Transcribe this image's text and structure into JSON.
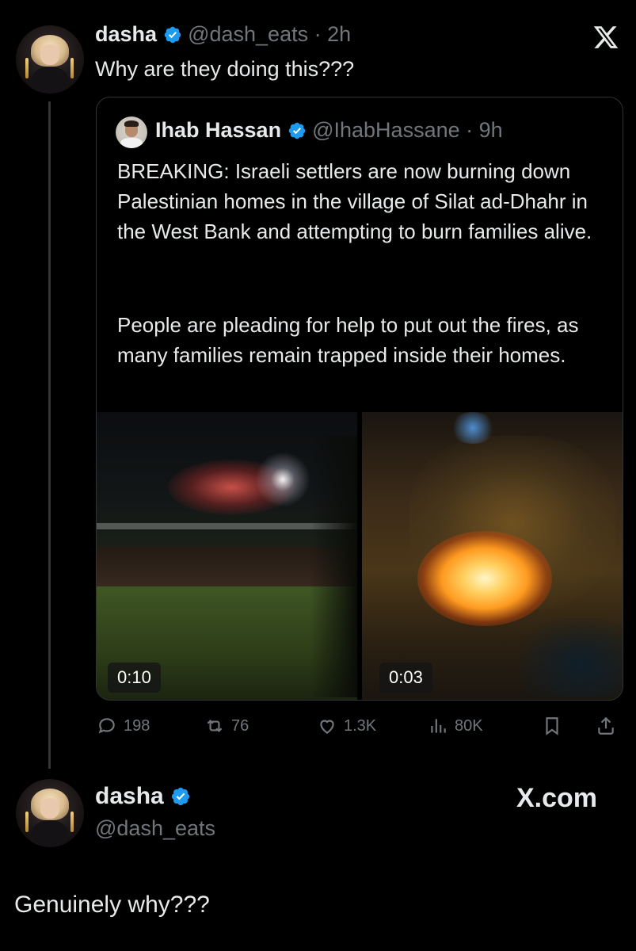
{
  "main_post": {
    "display_name": "dasha",
    "handle": "@dash_eats",
    "time": "· 2h",
    "text": "Why are they doing this???"
  },
  "quoted_post": {
    "display_name": "Ihab Hassan",
    "handle": "@IhabHassane",
    "time": "· 9h",
    "text_p1": "BREAKING: Israeli settlers are now burning down Palestinian homes in the village of Silat ad-Dhahr in the West Bank and attempting to burn families alive.",
    "text_p2": "People are pleading for help to put out the fires, as many families remain trapped inside their homes.",
    "videos": [
      {
        "duration": "0:10"
      },
      {
        "duration": "0:03"
      }
    ]
  },
  "actions": {
    "replies": "198",
    "reposts": "76",
    "likes": "1.3K",
    "views": "80K"
  },
  "reply_post": {
    "display_name": "dasha",
    "handle": "@dash_eats",
    "text": "Genuinely why???"
  },
  "brand": {
    "logo_text": "X",
    "site": "X.com"
  },
  "colors": {
    "background": "#000000",
    "text": "#e7e9ea",
    "muted": "#71767b",
    "verified": "#1d9bf0",
    "border": "#2f3336"
  }
}
